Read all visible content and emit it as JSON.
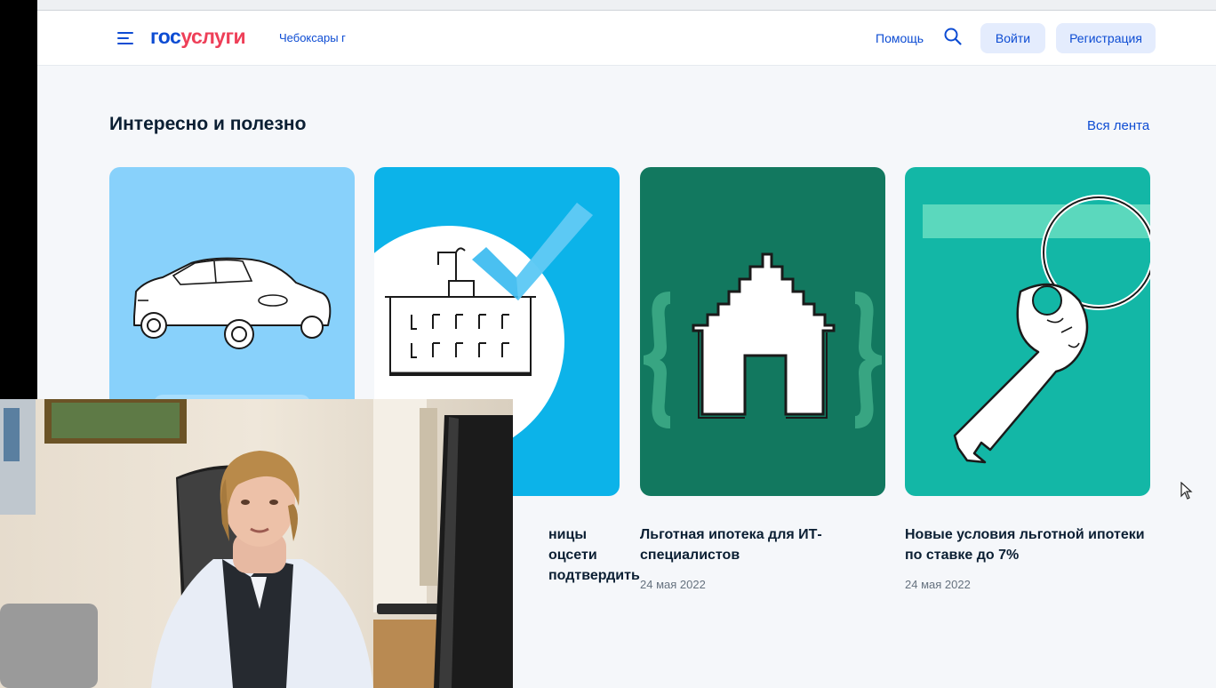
{
  "header": {
    "logo_part1": "гос",
    "logo_part2": "услуги",
    "city": "Чебоксары г",
    "help": "Помощь",
    "login": "Войти",
    "register": "Регистрация"
  },
  "section": {
    "title": "Интересно и полезно",
    "all_link": "Вся лента"
  },
  "cards": [
    {
      "title": "",
      "date": ""
    },
    {
      "title_lines": [
        "ницы",
        "оцсети",
        "подтвердить"
      ],
      "date": ""
    },
    {
      "title": "Льготная ипотека для ИТ-специалистов",
      "date": "24 мая 2022"
    },
    {
      "title": "Новые условия льготной ипотеки по ставке до 7%",
      "date": "24 мая 2022"
    }
  ],
  "icons": [
    "burger-menu-icon",
    "search-icon",
    "car-illustration",
    "building-check-illustration",
    "house-braces-illustration",
    "key-illustration",
    "mouse-cursor-icon"
  ],
  "colors": {
    "brand_blue": "#0d4cd3",
    "brand_red": "#ee3f58",
    "card1_bg": "#88d1fb",
    "card2_bg": "#0cb3e9",
    "card3_bg": "#12785f",
    "card4_bg": "#13b7a6"
  }
}
